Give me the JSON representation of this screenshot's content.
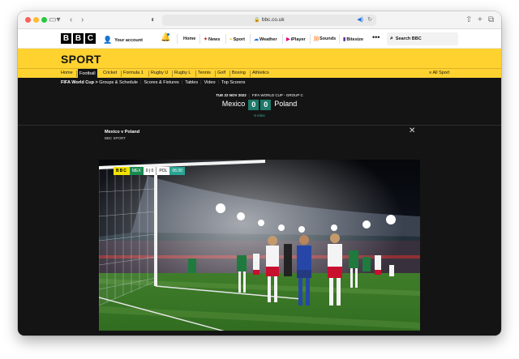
{
  "browser": {
    "url": "bbc.co.uk"
  },
  "bbc_header": {
    "logo_letters": [
      "B",
      "B",
      "C"
    ],
    "account_label": "Your account",
    "nav": [
      {
        "label": "Home",
        "icon": "home"
      },
      {
        "label": "News",
        "icon": "news-icon"
      },
      {
        "label": "Sport",
        "icon": "sport-icon"
      },
      {
        "label": "Weather",
        "icon": "weather-icon"
      },
      {
        "label": "iPlayer",
        "icon": "iplayer-icon"
      },
      {
        "label": "Sounds",
        "icon": "sounds-icon"
      },
      {
        "label": "Bitesize",
        "icon": "bitesize-icon"
      }
    ],
    "search_label": "Search BBC"
  },
  "sport": {
    "title": "SPORT",
    "nav": [
      "Home",
      "Football",
      "Cricket",
      "Formula 1",
      "Rugby U",
      "Rugby L",
      "Tennis",
      "Golf",
      "Boxing",
      "Athletics"
    ],
    "active_nav": "Football",
    "all_sport": "All Sport"
  },
  "subnav": {
    "section": "FIFA World Cup",
    "links": [
      "Groups & Schedule",
      "Scores & Fixtures",
      "Tables",
      "Video",
      "Top Scorers"
    ]
  },
  "match": {
    "date": "TUE 22 NOV 2022",
    "competition": "FIFA WORLD CUP - GROUP C",
    "home_team": "Mexico",
    "away_team": "Poland",
    "home_score": "0",
    "away_score": "0",
    "minutes": "6 mins"
  },
  "video": {
    "title": "Mexico v Poland",
    "source": "BBC SPORT",
    "scorebug": {
      "brand": "BBC",
      "home": "MEX",
      "score": "0 | 0",
      "away": "POL",
      "clock": "06:30"
    }
  },
  "colors": {
    "sport_yellow": "#ffd230",
    "score_box": "#1d7a6a",
    "dark_bg": "#141414"
  }
}
